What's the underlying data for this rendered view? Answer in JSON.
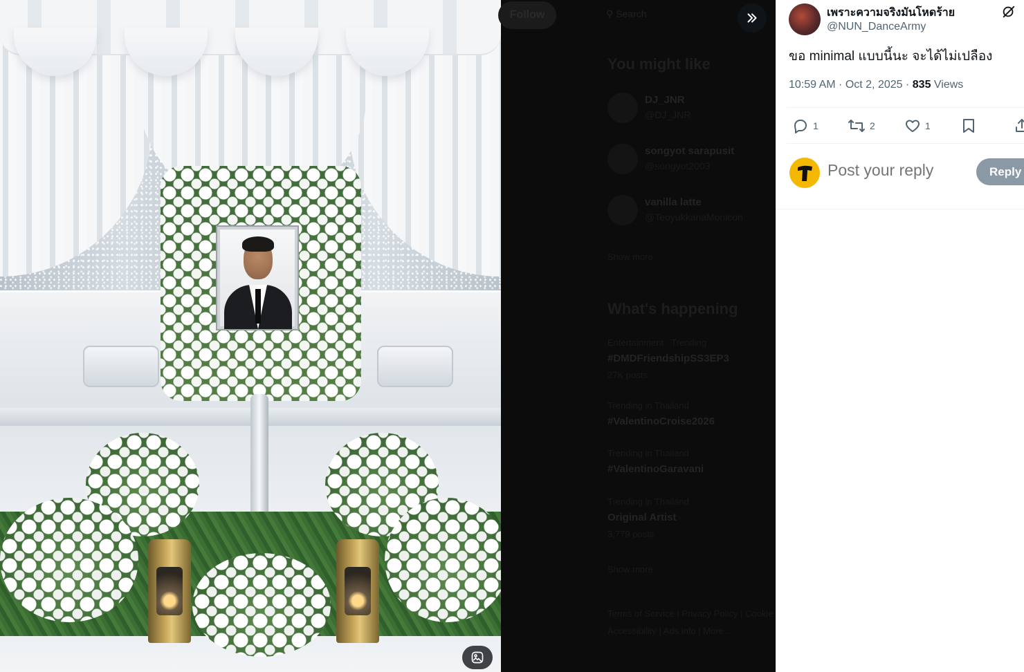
{
  "underlay": {
    "follow_label": "Follow",
    "search_placeholder": "Search",
    "you_might_like_title": "You might like",
    "suggested": [
      {
        "name": "DJ_JNR",
        "handle": "@DJ_JNR"
      },
      {
        "name": "songyot sarapusit",
        "handle": "@songyot2003"
      },
      {
        "name": "vanilla latte",
        "handle": "@TeoyukkanaMonicon"
      }
    ],
    "show_more_1": "Show more",
    "whats_happening_title": "What's happening",
    "trends": [
      {
        "context": "Entertainment · Trending",
        "title": "#DMDFriendshipSS3EP3",
        "count": "27K posts"
      },
      {
        "context": "Trending in Thailand",
        "title": "#ValentinoCroise2026",
        "count": ""
      },
      {
        "context": "Trending in Thailand",
        "title": "#ValentinoGaravani",
        "count": ""
      },
      {
        "context": "Trending in Thailand",
        "title": "Original Artist",
        "count": "3,779 posts"
      }
    ],
    "show_more_2": "Show more",
    "footer_links": [
      "Terms of Service",
      "Privacy Policy",
      "Cookie Policy",
      "Accessibility",
      "Ads info",
      "More ..."
    ]
  },
  "media": {
    "alt_badge_icon": "image-description-icon",
    "collapse_icon": "double-chevron-right-icon"
  },
  "post": {
    "author_name": "เพราะความจริงมันโหดร้าย",
    "author_handle": "@NUN_DanceArmy",
    "text": "ขอ minimal แบบนี้นะ จะได้ไม่เปลือง",
    "time": "10:59 AM · Oct 2, 2025 · ",
    "views_count": "835",
    "views_label": " Views",
    "actions": {
      "replies": "1",
      "reposts": "2",
      "likes": "1"
    },
    "reply_placeholder": "Post your reply",
    "reply_button": "Reply"
  },
  "colors": {
    "panel_bg": "#ffffff",
    "text_primary": "#0f1419",
    "text_secondary": "#536471",
    "reply_button_bg": "#8b98a5",
    "underlay_bg": "#0c0c0c"
  }
}
